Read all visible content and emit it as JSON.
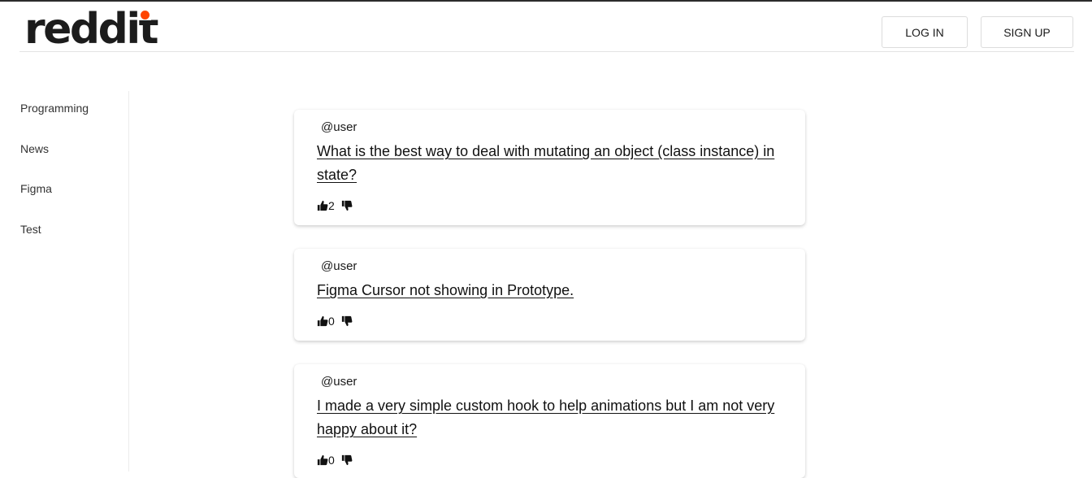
{
  "header": {
    "logo": "reddit",
    "login_label": "LOG IN",
    "signup_label": "SIGN UP",
    "accent_color": "#ff4500"
  },
  "sidebar": {
    "items": [
      {
        "label": "Programming"
      },
      {
        "label": "News"
      },
      {
        "label": "Figma"
      },
      {
        "label": "Test"
      }
    ]
  },
  "posts": [
    {
      "user": "@user",
      "title": "What is the best way to deal with mutating an object (class instance) in state?",
      "votes": "2",
      "upvote_icon": "thumbs-up-icon",
      "downvote_icon": "thumbs-down-icon"
    },
    {
      "user": "@user",
      "title": "Figma Cursor not showing in Prototype.",
      "votes": "0",
      "upvote_icon": "thumbs-up-icon",
      "downvote_icon": "thumbs-down-icon"
    },
    {
      "user": "@user",
      "title": "I made a very simple custom hook to help animations but I am not very happy about it?",
      "votes": "0",
      "upvote_icon": "thumbs-up-icon",
      "downvote_icon": "thumbs-down-icon"
    }
  ]
}
